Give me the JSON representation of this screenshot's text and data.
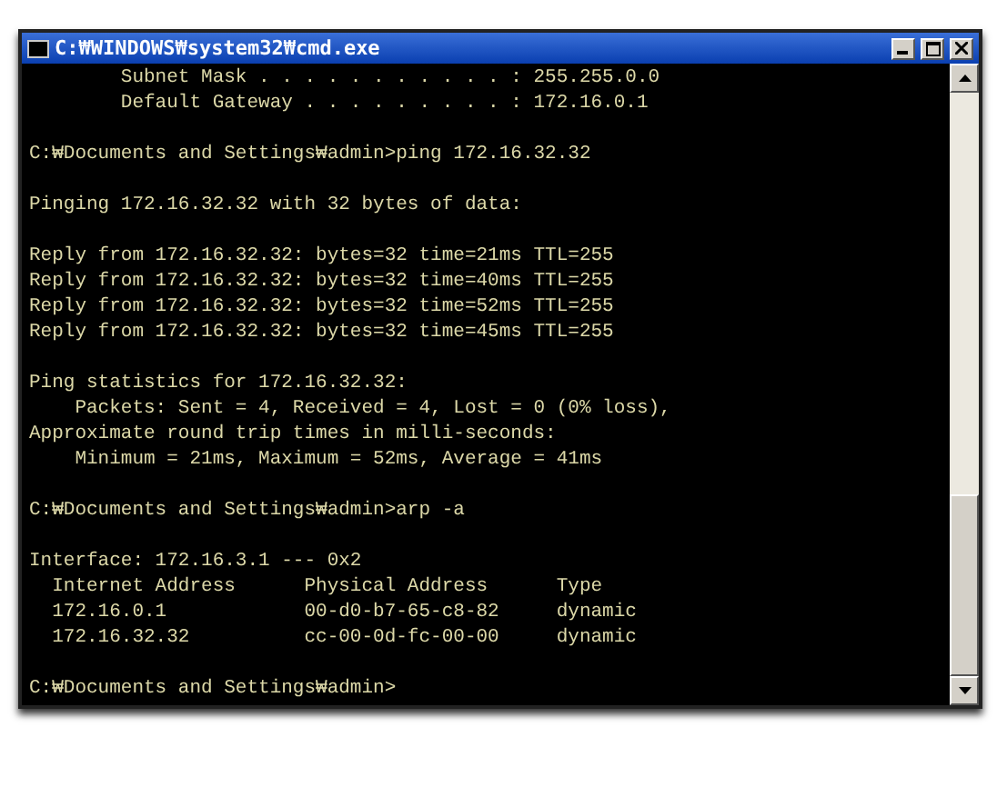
{
  "window": {
    "title": "C:₩WINDOWS₩system32₩cmd.exe"
  },
  "console": {
    "lines": [
      {
        "kind": "text",
        "text": "        Subnet Mask . . . . . . . . . . . : 255.255.0.0"
      },
      {
        "kind": "text",
        "text": "        Default Gateway . . . . . . . . . : 172.16.0.1"
      },
      {
        "kind": "blank"
      },
      {
        "kind": "text",
        "text": "C:₩Documents and Settings₩admin>ping 172.16.32.32"
      },
      {
        "kind": "blank"
      },
      {
        "kind": "text",
        "text": "Pinging 172.16.32.32 with 32 bytes of data:"
      },
      {
        "kind": "blank"
      },
      {
        "kind": "text",
        "text": "Reply from 172.16.32.32: bytes=32 time=21ms TTL=255"
      },
      {
        "kind": "text",
        "text": "Reply from 172.16.32.32: bytes=32 time=40ms TTL=255"
      },
      {
        "kind": "text",
        "text": "Reply from 172.16.32.32: bytes=32 time=52ms TTL=255"
      },
      {
        "kind": "text",
        "text": "Reply from 172.16.32.32: bytes=32 time=45ms TTL=255"
      },
      {
        "kind": "blank"
      },
      {
        "kind": "text",
        "text": "Ping statistics for 172.16.32.32:"
      },
      {
        "kind": "text",
        "text": "    Packets: Sent = 4, Received = 4, Lost = 0 (0% loss),"
      },
      {
        "kind": "text",
        "text": "Approximate round trip times in milli-seconds:"
      },
      {
        "kind": "text",
        "text": "    Minimum = 21ms, Maximum = 52ms, Average = 41ms"
      },
      {
        "kind": "blank"
      },
      {
        "kind": "text",
        "text": "C:₩Documents and Settings₩admin>arp -a"
      },
      {
        "kind": "blank"
      },
      {
        "kind": "text",
        "text": "Interface: 172.16.3.1 --- 0x2"
      },
      {
        "kind": "text",
        "text": "  Internet Address      Physical Address      Type"
      },
      {
        "kind": "text",
        "text": "  172.16.0.1            00-d0-b7-65-c8-82     dynamic"
      },
      {
        "kind": "text",
        "text": "  172.16.32.32          cc-00-0d-fc-00-00     dynamic"
      },
      {
        "kind": "blank"
      },
      {
        "kind": "text",
        "text": "C:₩Documents and Settings₩admin>"
      }
    ]
  }
}
